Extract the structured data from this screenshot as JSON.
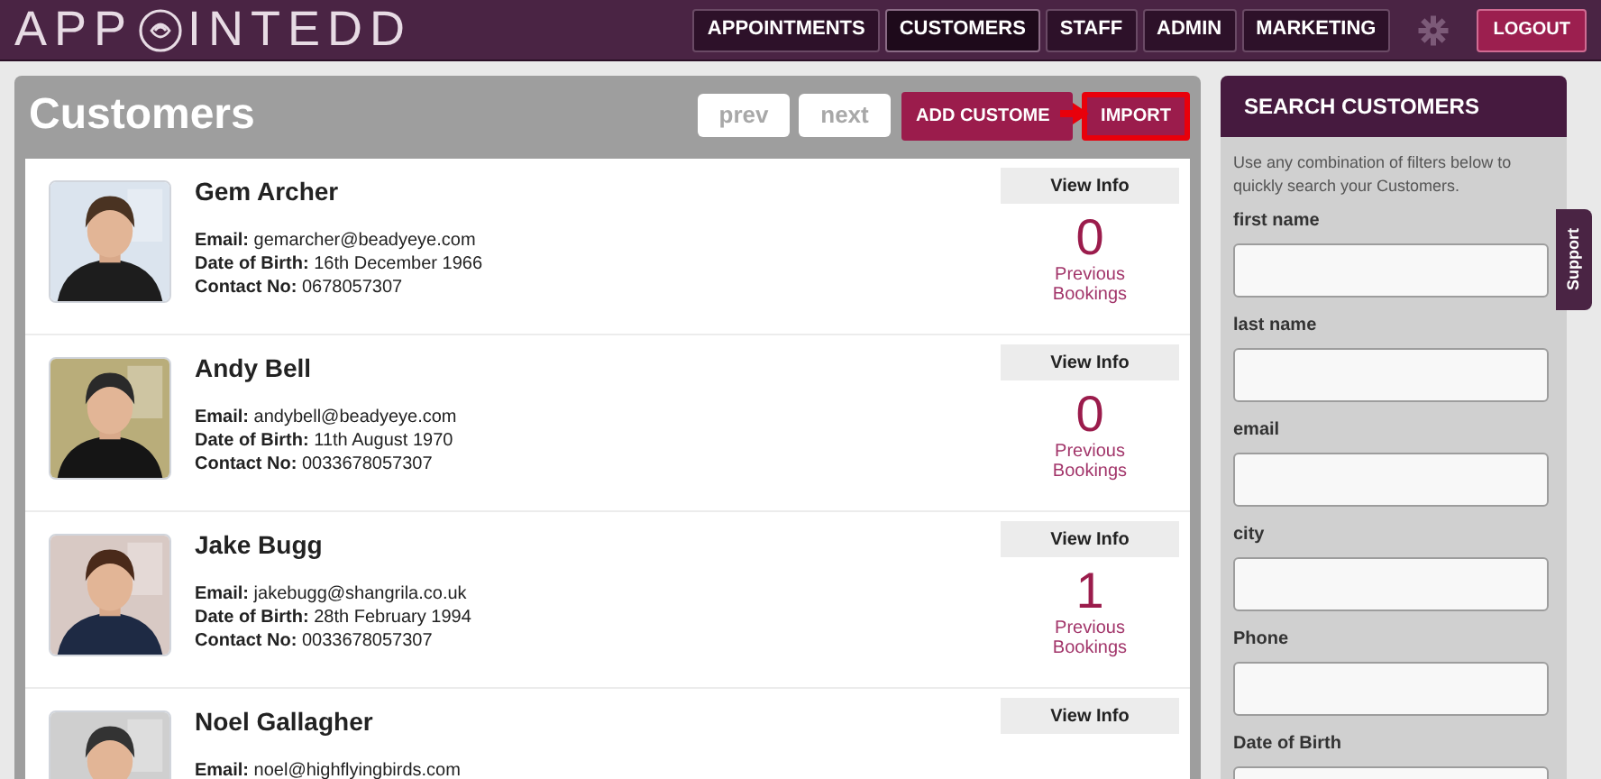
{
  "header": {
    "logo_start": "APP",
    "logo_end": "INTEDD",
    "nav": [
      {
        "label": "APPOINTMENTS",
        "selected": false
      },
      {
        "label": "CUSTOMERS",
        "selected": true
      },
      {
        "label": "STAFF",
        "selected": false
      },
      {
        "label": "ADMIN",
        "selected": false
      },
      {
        "label": "MARKETING",
        "selected": false
      }
    ],
    "logout": "LOGOUT"
  },
  "main": {
    "title": "Customers",
    "pager": [
      {
        "label": "prev",
        "disabled": true
      },
      {
        "label": "next",
        "disabled": true
      }
    ],
    "add_button": "ADD CUSTOME",
    "import_button": {
      "label": "IMPORT",
      "highlighted": true
    },
    "customers": [
      {
        "name": "Gem Archer",
        "fields": [
          {
            "label": "Email:",
            "value": "gemarcher@beadyeye.com"
          },
          {
            "label": "Date of Birth:",
            "value": "16th December 1966"
          },
          {
            "label": "Contact No:",
            "value": "0678057307"
          }
        ],
        "view": "View Info",
        "count": "0",
        "count_label": "Previous Bookings"
      },
      {
        "name": "Andy Bell",
        "fields": [
          {
            "label": "Email:",
            "value": "andybell@beadyeye.com"
          },
          {
            "label": "Date of Birth:",
            "value": "11th August 1970"
          },
          {
            "label": "Contact No:",
            "value": "0033678057307"
          }
        ],
        "view": "View Info",
        "count": "0",
        "count_label": "Previous Bookings"
      },
      {
        "name": "Jake Bugg",
        "fields": [
          {
            "label": "Email:",
            "value": "jakebugg@shangrila.co.uk"
          },
          {
            "label": "Date of Birth:",
            "value": "28th February 1994"
          },
          {
            "label": "Contact No:",
            "value": "0033678057307"
          }
        ],
        "view": "View Info",
        "count": "1",
        "count_label": "Previous Bookings"
      },
      {
        "name": "Noel Gallagher",
        "fields": [
          {
            "label": "Email:",
            "value": "noel@highflyingbirds.com"
          }
        ],
        "view": "View Info"
      }
    ]
  },
  "search": {
    "title": "SEARCH CUSTOMERS",
    "hint": "Use any combination of filters below to quickly search your Customers.",
    "fields": [
      "first name",
      "last name",
      "email",
      "city",
      "Phone",
      "Date of Birth"
    ]
  },
  "support_tab": "Support"
}
